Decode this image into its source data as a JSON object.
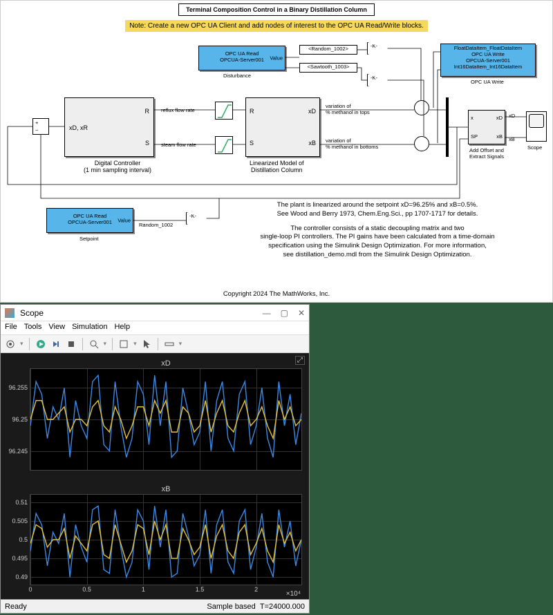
{
  "diagram": {
    "title": "Terminal Composition Control in a Binary Distillation Column",
    "note": "Note: Create a new OPC UA Client and add nodes of interest to the OPC UA Read/Write blocks.",
    "opc_read_disturbance": {
      "line1": "OPC UA Read",
      "line2": "OPCUA-Server001",
      "port": "Value",
      "caption": "Disturbance"
    },
    "opc_read_setpoint": {
      "line1": "OPC UA Read",
      "line2": "OPCUA-Server001",
      "port": "Value",
      "caption": "Setpoint"
    },
    "opc_write": {
      "line1": "FloatDataItem_FloatDataItem",
      "line2": "OPC UA Write",
      "line3": "OPCUA-Server001",
      "line4": "Int16DataItem_Int16DataItem",
      "caption": "OPC UA Write"
    },
    "tag_random": "<Random_1002>",
    "tag_sawtooth": "<Sawtooth_1003>",
    "random_lbl": "Random_1002",
    "gain": "-K-",
    "sum_plus": "+",
    "sum_minus": "−",
    "controller_in": "xD, xR",
    "controller_outR": "R",
    "controller_outS": "S",
    "controller_lblR": "reflux flow rate",
    "controller_lblS": "steam flow rate",
    "controller_caption1": "Digital Controller",
    "controller_caption2": "(1 min sampling interval)",
    "model_inR": "R",
    "model_inS": "S",
    "model_outD": "xD",
    "model_outB": "xB",
    "model_lblD1": "variation of",
    "model_lblD2": "% methanol in tops",
    "model_lblB1": "variation of",
    "model_lblB2": "% methanol in bottoms",
    "model_caption1": "Linearized Model of",
    "model_caption2": "Distillation Column",
    "offset_in1": "x",
    "offset_in2": "SP",
    "offset_out1": "xD",
    "offset_out2": "xB",
    "offset_caption1": "Add Offset and",
    "offset_caption2": "Extract Signals",
    "scope_caption": "Scope",
    "sig_xD": "xD",
    "sig_xB": "xB",
    "body1": "The plant is linearized around the setpoint xD=96.25% and xB=0.5%.",
    "body2": "See Wood and Berry 1973, Chem.Eng.Sci., pp 1707-1717 for details.",
    "body3": "The controller consists of a static decoupling matrix and two",
    "body4": "single-loop PI controllers. The PI gains have been calculated from a time-domain",
    "body5": "specification using the Simulink Design Optimization. For more information,",
    "body6": "see distillation_demo.mdl from the Simulink Design Optimization.",
    "copyright": "Copyright 2024 The MathWorks, Inc."
  },
  "scope": {
    "title": "Scope",
    "menu": {
      "file": "File",
      "tools": "Tools",
      "view": "View",
      "sim": "Simulation",
      "help": "Help"
    },
    "status_left": "Ready",
    "status_right1": "Sample based",
    "status_right2": "T=24000.000",
    "xaxis_exp": "×10⁴"
  },
  "chart_data": [
    {
      "type": "line",
      "title": "xD",
      "xlabel": "",
      "ylabel": "",
      "xlim": [
        0,
        24000
      ],
      "ylim": [
        96.242,
        96.258
      ],
      "xticks": [
        0,
        5000,
        10000,
        15000,
        20000
      ],
      "xtick_labels": [
        "0",
        "0.5",
        "1",
        "1.5",
        "2"
      ],
      "yticks": [
        96.245,
        96.25,
        96.255
      ],
      "series": [
        {
          "name": "signal1",
          "color": "#3c8ae6",
          "x": [
            0,
            500,
            1000,
            1500,
            2000,
            2500,
            3000,
            3500,
            4000,
            4500,
            5000,
            5500,
            6000,
            6500,
            7000,
            7500,
            8000,
            8500,
            9000,
            9500,
            10000,
            10500,
            11000,
            11500,
            12000,
            12500,
            13000,
            13500,
            14000,
            14500,
            15000,
            15500,
            16000,
            16500,
            17000,
            17500,
            18000,
            18500,
            19000,
            19500,
            20000,
            20500,
            21000,
            21500,
            22000,
            22500,
            23000,
            23500,
            24000
          ],
          "y": [
            96.249,
            96.256,
            96.254,
            96.247,
            96.252,
            96.25,
            96.255,
            96.244,
            96.253,
            96.249,
            96.247,
            96.256,
            96.257,
            96.246,
            96.245,
            96.256,
            96.249,
            96.244,
            96.247,
            96.256,
            96.254,
            96.246,
            96.257,
            96.249,
            96.256,
            96.244,
            96.245,
            96.255,
            96.251,
            96.246,
            96.248,
            96.256,
            96.245,
            96.253,
            96.256,
            96.247,
            96.245,
            96.254,
            96.256,
            96.246,
            96.249,
            96.255,
            96.247,
            96.244,
            96.256,
            96.249,
            96.254,
            96.246,
            96.251
          ]
        },
        {
          "name": "signal2",
          "color": "#e6c23c",
          "x": [
            0,
            500,
            1000,
            1500,
            2000,
            2500,
            3000,
            3500,
            4000,
            4500,
            5000,
            5500,
            6000,
            6500,
            7000,
            7500,
            8000,
            8500,
            9000,
            9500,
            10000,
            10500,
            11000,
            11500,
            12000,
            12500,
            13000,
            13500,
            14000,
            14500,
            15000,
            15500,
            16000,
            16500,
            17000,
            17500,
            18000,
            18500,
            19000,
            19500,
            20000,
            20500,
            21000,
            21500,
            22000,
            22500,
            23000,
            23500,
            24000
          ],
          "y": [
            96.25,
            96.253,
            96.253,
            96.25,
            96.25,
            96.251,
            96.252,
            96.248,
            96.25,
            96.25,
            96.249,
            96.252,
            96.253,
            96.249,
            96.248,
            96.252,
            96.25,
            96.247,
            96.249,
            96.252,
            96.252,
            96.249,
            96.253,
            96.251,
            96.253,
            96.248,
            96.248,
            96.252,
            96.251,
            96.248,
            96.249,
            96.253,
            96.248,
            96.251,
            96.253,
            96.249,
            96.248,
            96.251,
            96.253,
            96.249,
            96.25,
            96.252,
            96.249,
            96.247,
            96.253,
            96.25,
            96.252,
            96.249,
            96.25
          ]
        }
      ]
    },
    {
      "type": "line",
      "title": "xB",
      "xlabel": "",
      "ylabel": "",
      "xlim": [
        0,
        24000
      ],
      "ylim": [
        0.488,
        0.512
      ],
      "xticks": [
        0,
        5000,
        10000,
        15000,
        20000
      ],
      "xtick_labels": [
        "0",
        "0.5",
        "1",
        "1.5",
        "2"
      ],
      "yticks": [
        0.49,
        0.495,
        0.5,
        0.505,
        0.51
      ],
      "series": [
        {
          "name": "signal1",
          "color": "#3c8ae6",
          "x": [
            0,
            500,
            1000,
            1500,
            2000,
            2500,
            3000,
            3500,
            4000,
            4500,
            5000,
            5500,
            6000,
            6500,
            7000,
            7500,
            8000,
            8500,
            9000,
            9500,
            10000,
            10500,
            11000,
            11500,
            12000,
            12500,
            13000,
            13500,
            14000,
            14500,
            15000,
            15500,
            16000,
            16500,
            17000,
            17500,
            18000,
            18500,
            19000,
            19500,
            20000,
            20500,
            21000,
            21500,
            22000,
            22500,
            23000,
            23500,
            24000
          ],
          "y": [
            0.497,
            0.507,
            0.504,
            0.493,
            0.502,
            0.499,
            0.507,
            0.49,
            0.504,
            0.498,
            0.494,
            0.508,
            0.509,
            0.492,
            0.491,
            0.508,
            0.498,
            0.49,
            0.494,
            0.508,
            0.505,
            0.492,
            0.509,
            0.498,
            0.508,
            0.49,
            0.491,
            0.507,
            0.501,
            0.493,
            0.496,
            0.508,
            0.491,
            0.504,
            0.508,
            0.494,
            0.491,
            0.505,
            0.508,
            0.492,
            0.498,
            0.507,
            0.494,
            0.49,
            0.508,
            0.498,
            0.505,
            0.493,
            0.5
          ]
        },
        {
          "name": "signal2",
          "color": "#e6c23c",
          "x": [
            0,
            500,
            1000,
            1500,
            2000,
            2500,
            3000,
            3500,
            4000,
            4500,
            5000,
            5500,
            6000,
            6500,
            7000,
            7500,
            8000,
            8500,
            9000,
            9500,
            10000,
            10500,
            11000,
            11500,
            12000,
            12500,
            13000,
            13500,
            14000,
            14500,
            15000,
            15500,
            16000,
            16500,
            17000,
            17500,
            18000,
            18500,
            19000,
            19500,
            20000,
            20500,
            21000,
            21500,
            22000,
            22500,
            23000,
            23500,
            24000
          ],
          "y": [
            0.499,
            0.504,
            0.503,
            0.498,
            0.5,
            0.5,
            0.503,
            0.495,
            0.501,
            0.499,
            0.497,
            0.504,
            0.505,
            0.496,
            0.495,
            0.504,
            0.499,
            0.494,
            0.497,
            0.504,
            0.503,
            0.496,
            0.505,
            0.5,
            0.504,
            0.495,
            0.495,
            0.503,
            0.5,
            0.496,
            0.498,
            0.504,
            0.495,
            0.501,
            0.504,
            0.497,
            0.495,
            0.502,
            0.504,
            0.496,
            0.499,
            0.503,
            0.497,
            0.494,
            0.504,
            0.499,
            0.502,
            0.497,
            0.5
          ]
        }
      ]
    }
  ]
}
